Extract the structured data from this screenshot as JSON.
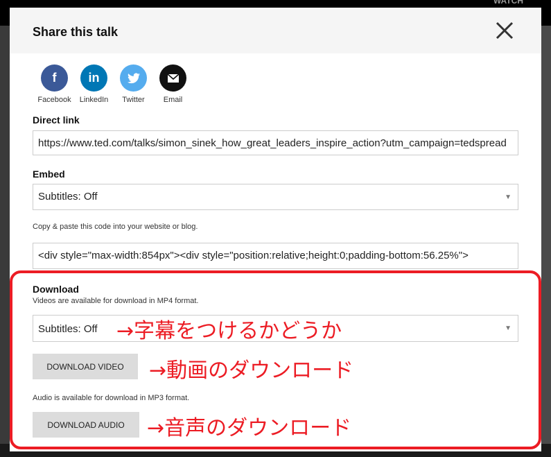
{
  "background": {
    "nav_label": "WATCH"
  },
  "modal": {
    "title": "Share this talk",
    "close_icon": "close-icon",
    "social": [
      {
        "label": "Facebook",
        "icon": "facebook-icon",
        "color": "#3b5998",
        "glyph": "f"
      },
      {
        "label": "LinkedIn",
        "icon": "linkedin-icon",
        "color": "#0077b5",
        "glyph": "in"
      },
      {
        "label": "Twitter",
        "icon": "twitter-icon",
        "color": "#55acee",
        "glyph": "🐦"
      },
      {
        "label": "Email",
        "icon": "email-icon",
        "color": "#111111",
        "glyph": "✉"
      }
    ],
    "direct_link": {
      "label": "Direct link",
      "value": "https://www.ted.com/talks/simon_sinek_how_great_leaders_inspire_action?utm_campaign=tedspread"
    },
    "embed": {
      "label": "Embed",
      "subtitles": "Subtitles: Off",
      "hint": "Copy & paste this code into your website or blog.",
      "code": "<div style=\"max-width:854px\"><div style=\"position:relative;height:0;padding-bottom:56.25%\">"
    },
    "download": {
      "label": "Download",
      "video_hint": "Videos are available for download in MP4 format.",
      "subtitles": "Subtitles: Off",
      "video_button": "DOWNLOAD VIDEO",
      "audio_hint": "Audio is available for download in MP3 format.",
      "audio_button": "DOWNLOAD AUDIO"
    }
  },
  "annotations": {
    "color": "#ec1c24",
    "subtitles_note": "→字幕をつけるかどうか",
    "video_note": "→動画のダウンロード",
    "audio_note": "→音声のダウンロード"
  }
}
